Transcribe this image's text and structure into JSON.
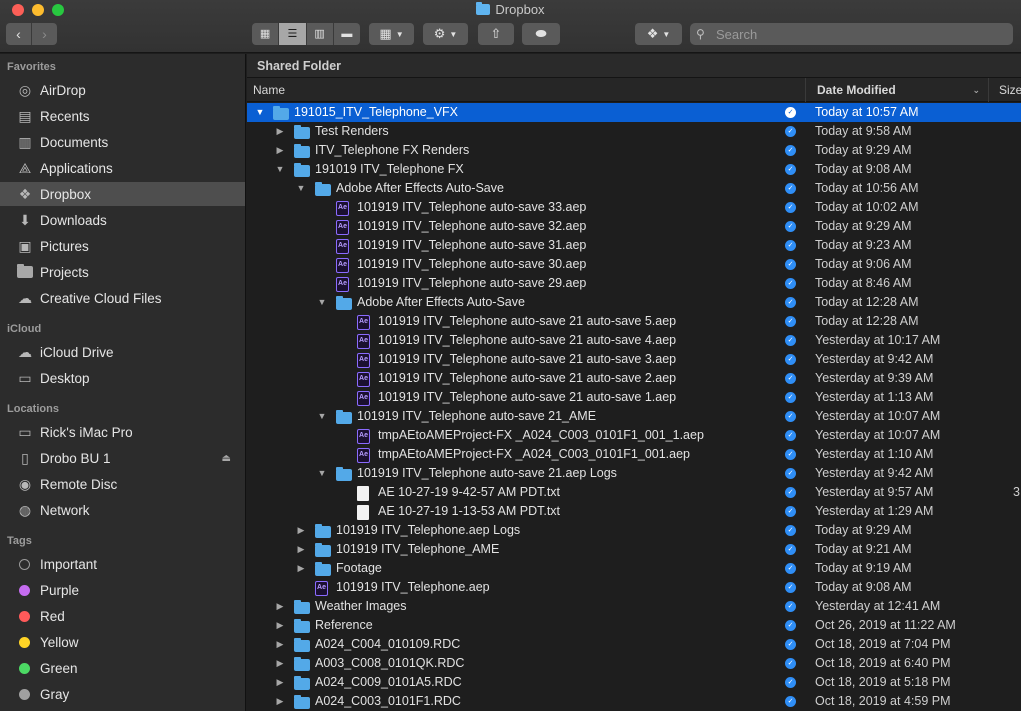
{
  "window": {
    "title": "Dropbox"
  },
  "toolbar": {
    "back": "‹",
    "forward": "›",
    "search_placeholder": "Search"
  },
  "sidebar": {
    "favorites_label": "Favorites",
    "favorites": [
      {
        "label": "AirDrop",
        "icon": "airdrop-icon",
        "glyph": "◎"
      },
      {
        "label": "Recents",
        "icon": "recents-icon",
        "glyph": "▤"
      },
      {
        "label": "Documents",
        "icon": "documents-icon",
        "glyph": "▥"
      },
      {
        "label": "Applications",
        "icon": "applications-icon",
        "glyph": "⟁"
      },
      {
        "label": "Dropbox",
        "icon": "dropbox-icon",
        "glyph": "❖"
      },
      {
        "label": "Downloads",
        "icon": "downloads-icon",
        "glyph": "⬇"
      },
      {
        "label": "Pictures",
        "icon": "pictures-icon",
        "glyph": "▣"
      },
      {
        "label": "Projects",
        "icon": "folder-icon",
        "glyph": ""
      },
      {
        "label": "Creative Cloud Files",
        "icon": "creative-cloud-icon",
        "glyph": "☁"
      }
    ],
    "icloud_label": "iCloud",
    "icloud": [
      {
        "label": "iCloud Drive",
        "icon": "cloud-icon",
        "glyph": "☁"
      },
      {
        "label": "Desktop",
        "icon": "desktop-icon",
        "glyph": "▭"
      }
    ],
    "locations_label": "Locations",
    "locations": [
      {
        "label": "Rick's iMac Pro",
        "icon": "computer-icon",
        "glyph": "▭"
      },
      {
        "label": "Drobo BU 1",
        "icon": "drive-icon",
        "glyph": "▯"
      },
      {
        "label": "Remote Disc",
        "icon": "disc-icon",
        "glyph": "◉"
      },
      {
        "label": "Network",
        "icon": "network-icon",
        "glyph": "◍"
      }
    ],
    "tags_label": "Tags",
    "tags": [
      {
        "label": "Important",
        "color": "#2c2c2c"
      },
      {
        "label": "Purple",
        "color": "#c56cf0"
      },
      {
        "label": "Red",
        "color": "#ff5a5a"
      },
      {
        "label": "Yellow",
        "color": "#ffd426"
      },
      {
        "label": "Green",
        "color": "#4cd964"
      },
      {
        "label": "Gray",
        "color": "#a0a0a0"
      }
    ]
  },
  "main": {
    "path_title": "Shared Folder",
    "columns": {
      "name": "Name",
      "date": "Date Modified",
      "size": "Size"
    },
    "rows": [
      {
        "name": "191015_ITV_Telephone_VFX",
        "date": "Today at 10:57 AM",
        "type": "folder",
        "depth": 0,
        "disclosure": "open",
        "selected": true
      },
      {
        "name": "Test Renders",
        "date": "Today at 9:58 AM",
        "type": "folder",
        "depth": 1,
        "disclosure": "closed"
      },
      {
        "name": "ITV_Telephone FX Renders",
        "date": "Today at 9:29 AM",
        "type": "folder",
        "depth": 1,
        "disclosure": "closed"
      },
      {
        "name": "191019 ITV_Telephone FX",
        "date": "Today at 9:08 AM",
        "type": "folder",
        "depth": 1,
        "disclosure": "open"
      },
      {
        "name": "Adobe After Effects Auto-Save",
        "date": "Today at 10:56 AM",
        "type": "folder",
        "depth": 2,
        "disclosure": "open"
      },
      {
        "name": "101919 ITV_Telephone auto-save 33.aep",
        "date": "Today at 10:02 AM",
        "type": "aep",
        "depth": 3
      },
      {
        "name": "101919 ITV_Telephone auto-save 32.aep",
        "date": "Today at 9:29 AM",
        "type": "aep",
        "depth": 3
      },
      {
        "name": "101919 ITV_Telephone auto-save 31.aep",
        "date": "Today at 9:23 AM",
        "type": "aep",
        "depth": 3
      },
      {
        "name": "101919 ITV_Telephone auto-save 30.aep",
        "date": "Today at 9:06 AM",
        "type": "aep",
        "depth": 3
      },
      {
        "name": "101919 ITV_Telephone auto-save 29.aep",
        "date": "Today at 8:46 AM",
        "type": "aep",
        "depth": 3
      },
      {
        "name": "Adobe After Effects Auto-Save",
        "date": "Today at 12:28 AM",
        "type": "folder",
        "depth": 3,
        "disclosure": "open"
      },
      {
        "name": "101919 ITV_Telephone auto-save 21 auto-save 5.aep",
        "date": "Today at 12:28 AM",
        "type": "aep",
        "depth": 4
      },
      {
        "name": "101919 ITV_Telephone auto-save 21 auto-save 4.aep",
        "date": "Yesterday at 10:17 AM",
        "type": "aep",
        "depth": 4
      },
      {
        "name": "101919 ITV_Telephone auto-save 21 auto-save 3.aep",
        "date": "Yesterday at 9:42 AM",
        "type": "aep",
        "depth": 4
      },
      {
        "name": "101919 ITV_Telephone auto-save 21 auto-save 2.aep",
        "date": "Yesterday at 9:39 AM",
        "type": "aep",
        "depth": 4
      },
      {
        "name": "101919 ITV_Telephone auto-save 21 auto-save 1.aep",
        "date": "Yesterday at 1:13 AM",
        "type": "aep",
        "depth": 4
      },
      {
        "name": "101919 ITV_Telephone auto-save 21_AME",
        "date": "Yesterday at 10:07 AM",
        "type": "folder",
        "depth": 3,
        "disclosure": "open"
      },
      {
        "name": "tmpAEtoAMEProject-FX _A024_C003_0101F1_001_1.aep",
        "date": "Yesterday at 10:07 AM",
        "type": "aep",
        "depth": 4
      },
      {
        "name": "tmpAEtoAMEProject-FX _A024_C003_0101F1_001.aep",
        "date": "Yesterday at 1:10 AM",
        "type": "aep",
        "depth": 4
      },
      {
        "name": "101919 ITV_Telephone auto-save 21.aep Logs",
        "date": "Yesterday at 9:42 AM",
        "type": "folder",
        "depth": 3,
        "disclosure": "open"
      },
      {
        "name": "AE 10-27-19 9-42-57 AM PDT.txt",
        "date": "Yesterday at 9:57 AM",
        "type": "txt",
        "depth": 4,
        "size": "3"
      },
      {
        "name": "AE 10-27-19 1-13-53 AM PDT.txt",
        "date": "Yesterday at 1:29 AM",
        "type": "txt",
        "depth": 4
      },
      {
        "name": "101919 ITV_Telephone.aep Logs",
        "date": "Today at 9:29 AM",
        "type": "folder",
        "depth": 2,
        "disclosure": "closed"
      },
      {
        "name": "101919 ITV_Telephone_AME",
        "date": "Today at 9:21 AM",
        "type": "folder",
        "depth": 2,
        "disclosure": "closed"
      },
      {
        "name": "Footage",
        "date": "Today at 9:19 AM",
        "type": "folder",
        "depth": 2,
        "disclosure": "closed"
      },
      {
        "name": "101919 ITV_Telephone.aep",
        "date": "Today at 9:08 AM",
        "type": "aep",
        "depth": 2
      },
      {
        "name": "Weather Images",
        "date": "Yesterday at 12:41 AM",
        "type": "folder",
        "depth": 1,
        "disclosure": "closed"
      },
      {
        "name": "Reference",
        "date": "Oct 26, 2019 at 11:22 AM",
        "type": "folder",
        "depth": 1,
        "disclosure": "closed"
      },
      {
        "name": "A024_C004_010109.RDC",
        "date": "Oct 18, 2019 at 7:04 PM",
        "type": "folder",
        "depth": 1,
        "disclosure": "closed"
      },
      {
        "name": "A003_C008_0101QK.RDC",
        "date": "Oct 18, 2019 at 6:40 PM",
        "type": "folder",
        "depth": 1,
        "disclosure": "closed"
      },
      {
        "name": "A024_C009_0101A5.RDC",
        "date": "Oct 18, 2019 at 5:18 PM",
        "type": "folder",
        "depth": 1,
        "disclosure": "closed"
      },
      {
        "name": "A024_C003_0101F1.RDC",
        "date": "Oct 18, 2019 at 4:59 PM",
        "type": "folder",
        "depth": 1,
        "disclosure": "closed"
      }
    ]
  }
}
